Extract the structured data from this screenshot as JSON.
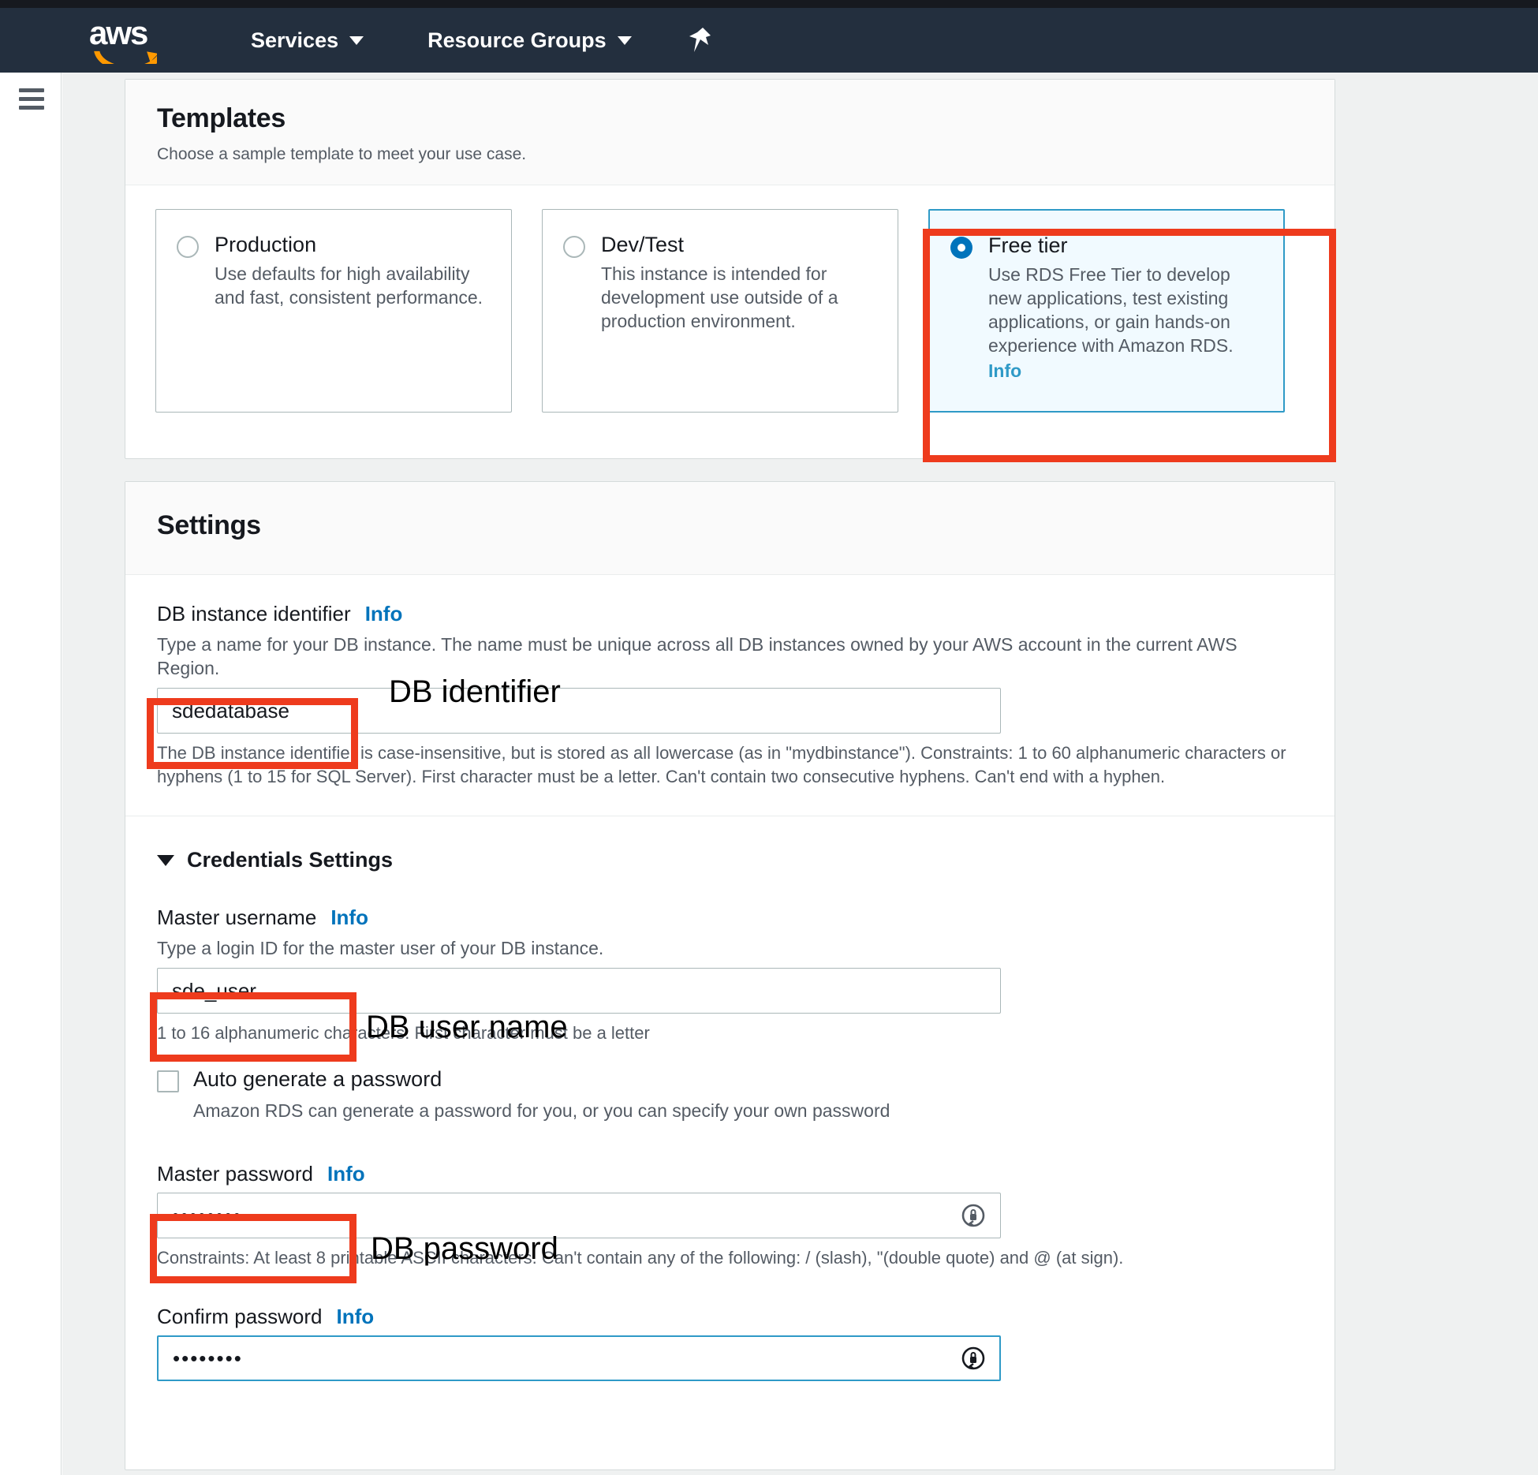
{
  "navbar": {
    "logo_alt": "aws",
    "services_label": "Services",
    "resource_groups_label": "Resource Groups",
    "pin_alt": "pin"
  },
  "templates": {
    "title": "Templates",
    "subtitle": "Choose a sample template to meet your use case.",
    "options": [
      {
        "name": "Production",
        "description": "Use defaults for high availability and fast, consistent performance.",
        "selected": false,
        "info_label": ""
      },
      {
        "name": "Dev/Test",
        "description": "This instance is intended for development use outside of a production environment.",
        "selected": false,
        "info_label": ""
      },
      {
        "name": "Free tier",
        "description": "Use RDS Free Tier to develop new applications, test existing applications, or gain hands-on experience with Amazon RDS.",
        "selected": true,
        "info_label": "Info"
      }
    ]
  },
  "settings": {
    "title": "Settings",
    "db_identifier": {
      "label": "DB instance identifier",
      "info_label": "Info",
      "hint": "Type a name for your DB instance. The name must be unique across all DB instances owned by your AWS account in the current AWS Region.",
      "value": "sdedatabase",
      "note": "The DB instance identifier is case-insensitive, but is stored as all lowercase (as in \"mydbinstance\"). Constraints: 1 to 60 alphanumeric characters or hyphens (1 to 15 for SQL Server). First character must be a letter. Can't contain two consecutive hyphens. Can't end with a hyphen."
    },
    "credentials": {
      "section_label": "Credentials Settings",
      "master_username": {
        "label": "Master username",
        "info_label": "Info",
        "hint": "Type a login ID for the master user of your DB instance.",
        "value": "sde_user",
        "note": "1 to 16 alphanumeric characters. First character must be a letter"
      },
      "auto_generate": {
        "label": "Auto generate a password",
        "sub": "Amazon RDS can generate a password for you, or you can specify your own password",
        "checked": false
      },
      "master_password": {
        "label": "Master password",
        "info_label": "Info",
        "value": "••••••••",
        "note": "Constraints: At least 8 printable ASCII characters. Can't contain any of the following: / (slash), \"(double quote) and @ (at sign).",
        "reveal_icon": "password-reveal-icon"
      },
      "confirm_password": {
        "label": "Confirm password",
        "info_label": "Info",
        "value": "••••••••",
        "reveal_icon": "password-reveal-icon"
      }
    }
  },
  "annotations": [
    {
      "text": "DB identifier"
    },
    {
      "text": "DB user name"
    },
    {
      "text": "DB password"
    }
  ],
  "colors": {
    "nav_bg": "#232f3e",
    "accent_orange": "#ff9900",
    "link_blue": "#0073bb",
    "selected_border": "#2f9ac7",
    "selected_bg": "#f1faff",
    "annotation_red": "#ee3b1d",
    "page_bg": "#eff1f1"
  }
}
